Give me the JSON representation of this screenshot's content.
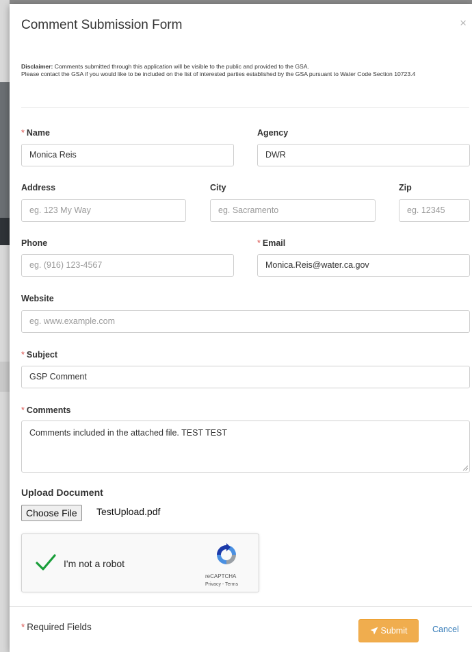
{
  "modal": {
    "title": "Comment Submission Form",
    "close_label": "×"
  },
  "disclaimer": {
    "bold": "Disclaimer:",
    "text_line1": " Comments submitted through this application will be visible to the public and provided to the GSA.",
    "text_line2": "Please contact the GSA if you would like to be included on the list of interested parties established by the GSA pursuant to Water Code Section 10723.4"
  },
  "required_marker": "*",
  "fields": {
    "name": {
      "label": "Name",
      "value": "Monica Reis",
      "required": true
    },
    "agency": {
      "label": "Agency",
      "value": "DWR"
    },
    "address": {
      "label": "Address",
      "placeholder": "eg. 123 My Way"
    },
    "city": {
      "label": "City",
      "placeholder": "eg. Sacramento"
    },
    "zip": {
      "label": "Zip",
      "placeholder": "eg. 12345"
    },
    "phone": {
      "label": "Phone",
      "placeholder": "eg. (916) 123-4567"
    },
    "email": {
      "label": "Email",
      "value": "Monica.Reis@water.ca.gov",
      "required": true
    },
    "website": {
      "label": "Website",
      "placeholder": "eg. www.example.com"
    },
    "subject": {
      "label": "Subject",
      "value": "GSP Comment",
      "required": true
    },
    "comments": {
      "label": "Comments",
      "value": "Comments included in the attached file. TEST TEST",
      "required": true
    }
  },
  "upload": {
    "label": "Upload Document",
    "button_label": "Choose File",
    "file_name": "TestUpload.pdf"
  },
  "captcha": {
    "label": "I'm not a robot",
    "brand": "reCAPTCHA",
    "links": "Privacy - Terms",
    "checked": true
  },
  "footer": {
    "required_note": "Required Fields",
    "submit_label": "Submit",
    "cancel_label": "Cancel"
  },
  "colors": {
    "required": "#d9534f",
    "submit": "#f0ad4e",
    "link": "#337ab7",
    "check": "#1a9e3a"
  }
}
